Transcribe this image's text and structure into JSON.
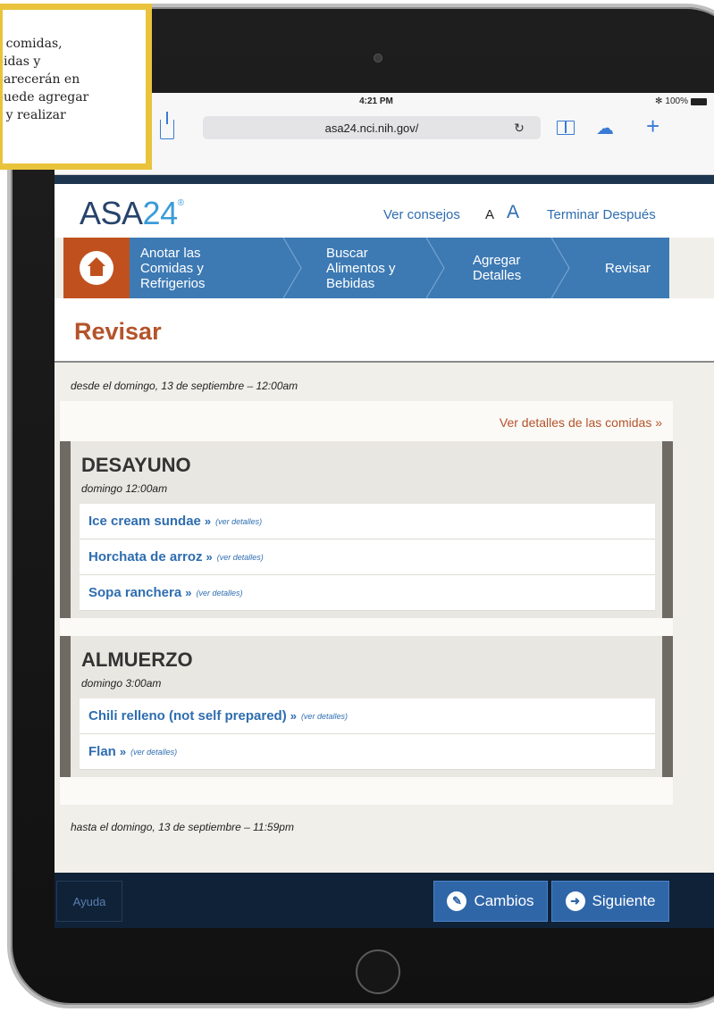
{
  "callout": {
    "lines": [
      "s comidas,",
      "bidas y",
      "parecerán en",
      "puede agregar",
      "s y realizar",
      "."
    ]
  },
  "status_bar": {
    "time": "4:21 PM",
    "battery": "100%",
    "bluetooth": "✻"
  },
  "browser": {
    "url": "asa24.nci.nih.gov/",
    "reload_glyph": "↻",
    "cloud_glyph": "☁",
    "plus_glyph": "+"
  },
  "header": {
    "logo_text": "ASA",
    "logo_number": "24",
    "logo_mark": "®",
    "tips_link": "Ver consejos",
    "font_small": "A",
    "font_large": "A",
    "finish_later_link": "Terminar Después"
  },
  "steps": {
    "step1": [
      "Anotar las",
      "Comidas y",
      "Refrigerios"
    ],
    "step2": [
      "Buscar",
      "Alimentos y",
      "Bebidas"
    ],
    "step3": [
      "Agregar",
      "Detalles"
    ],
    "step4": [
      "Revisar"
    ]
  },
  "page": {
    "title": "Revisar",
    "range_start": "desde el domingo, 13 de septiembre – 12:00am",
    "range_end": "hasta el domingo, 13 de septiembre – 11:59pm",
    "details_link": "Ver detalles de las comidas »"
  },
  "meals": {
    "breakfast": {
      "title": "DESAYUNO",
      "time": "domingo 12:00am",
      "foods": [
        {
          "name": "Ice cream sundae",
          "arrow": "»",
          "details": "(ver detalles)"
        },
        {
          "name": "Horchata de arroz",
          "arrow": "»",
          "details": "(ver detalles)"
        },
        {
          "name": "Sopa ranchera",
          "arrow": "»",
          "details": "(ver detalles)"
        }
      ]
    },
    "lunch": {
      "title": "ALMUERZO",
      "time": "domingo 3:00am",
      "foods": [
        {
          "name": "Chili relleno (not self prepared)",
          "arrow": "»",
          "details": "(ver detalles)"
        },
        {
          "name": "Flan",
          "arrow": "»",
          "details": "(ver detalles)"
        }
      ]
    }
  },
  "footer": {
    "help_label": "Ayuda",
    "changes_label": "Cambios",
    "changes_icon_glyph": "✎",
    "next_label": "Siguiente",
    "next_icon_glyph": "➜"
  },
  "colors": {
    "brand_blue": "#3d7ab4",
    "accent_orange": "#c0511e",
    "title_orange": "#b4532a",
    "link_blue": "#2e6db0",
    "footer_navy": "#0f2238",
    "callout_yellow": "#e9c33c"
  },
  "icons": {
    "share": "share-icon",
    "reload": "reload-icon",
    "bookmarks": "book-icon",
    "cloud": "cloud-icon",
    "new_tab": "plus-icon",
    "home": "home-icon",
    "edit": "pencil-icon",
    "next": "arrow-right-icon"
  }
}
